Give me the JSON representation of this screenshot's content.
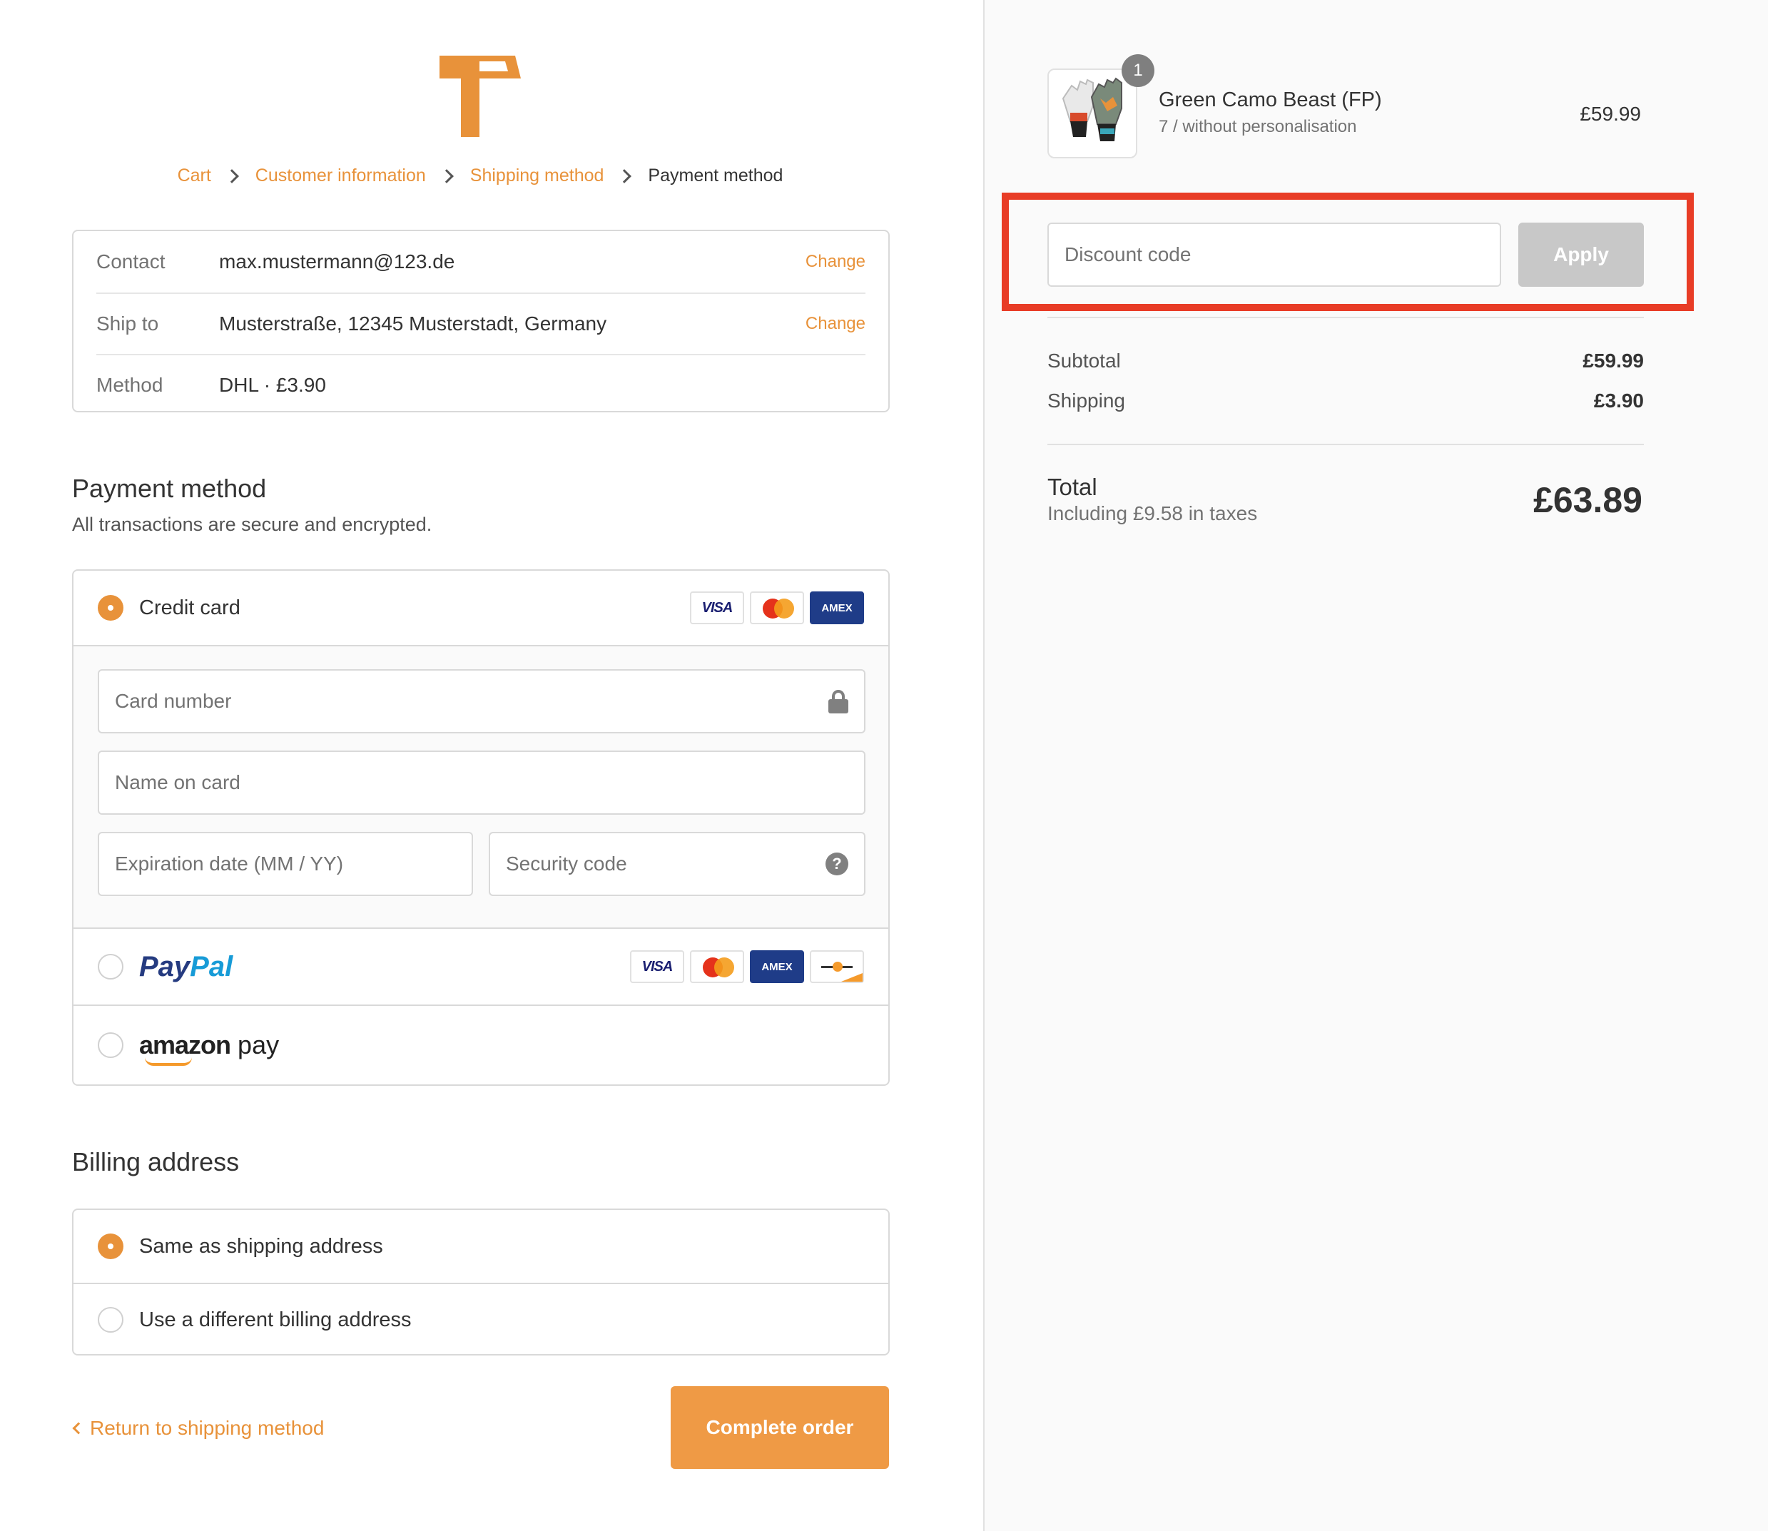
{
  "breadcrumb": {
    "cart": "Cart",
    "customer_information": "Customer information",
    "shipping_method": "Shipping method",
    "payment_method": "Payment method"
  },
  "review": {
    "contact_label": "Contact",
    "contact_value": "max.mustermann@123.de",
    "ship_label": "Ship to",
    "ship_value": "Musterstraße, 12345 Musterstadt, Germany",
    "method_label": "Method",
    "method_value": "DHL · £3.90",
    "change": "Change"
  },
  "payment": {
    "heading": "Payment method",
    "subtext": "All transactions are secure and encrypted.",
    "credit_card_label": "Credit card",
    "card_number_placeholder": "Card number",
    "name_placeholder": "Name on card",
    "expiry_placeholder": "Expiration date (MM / YY)",
    "security_placeholder": "Security code",
    "paypal_part1": "Pay",
    "paypal_part2": "Pal",
    "amazon_bold": "amazon",
    "amazon_pay": " pay",
    "visa": "VISA",
    "amex": "AMEX"
  },
  "billing": {
    "heading": "Billing address",
    "same": "Same as shipping address",
    "different": "Use a different billing address"
  },
  "footer": {
    "return_link": "Return to shipping method",
    "complete_button": "Complete order"
  },
  "summary": {
    "quantity": "1",
    "product_name": "Green Camo Beast (FP)",
    "product_variant": "7 / without personalisation",
    "product_price": "£59.99",
    "discount_placeholder": "Discount code",
    "apply_label": "Apply",
    "subtotal_label": "Subtotal",
    "subtotal_value": "£59.99",
    "shipping_label": "Shipping",
    "shipping_value": "£3.90",
    "total_label": "Total",
    "tax_note": "Including £9.58 in taxes",
    "total_value": "£63.89"
  },
  "colors": {
    "accent": "#e8923a",
    "highlight": "#e83c26",
    "apply_disabled": "#c8c8c8"
  }
}
